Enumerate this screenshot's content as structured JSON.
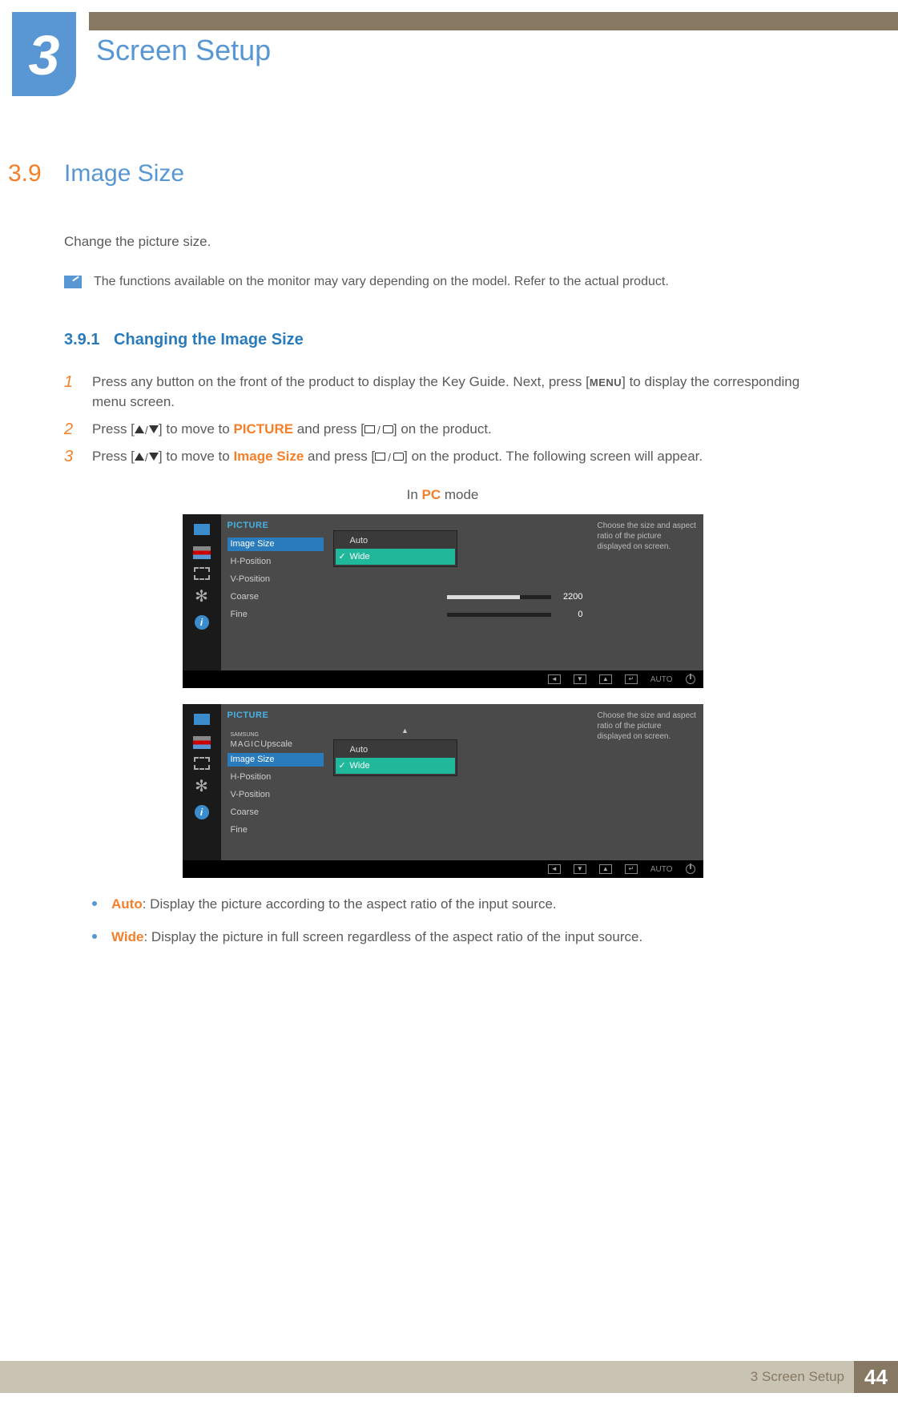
{
  "chapter": {
    "number": "3",
    "title": "Screen Setup"
  },
  "section": {
    "number": "3.9",
    "title": "Image Size"
  },
  "intro": "Change the picture size.",
  "note": "The functions available on the monitor may vary depending on the model. Refer to the actual product.",
  "subsection": {
    "number": "3.9.1",
    "title": "Changing the Image Size"
  },
  "steps": {
    "s1": {
      "pre": "Press any button on the front of the product to display the Key Guide. Next, press [",
      "menu": "MENU",
      "post": "] to display the corresponding menu screen."
    },
    "s2": {
      "pre": "Press [",
      "mid": "] to move to ",
      "kw": "PICTURE",
      "mid2": " and press [",
      "post": "] on the product."
    },
    "s3": {
      "pre": "Press [",
      "mid": "] to move to ",
      "kw": "Image Size",
      "mid2": " and press [",
      "post": "] on the product. The following screen will appear."
    }
  },
  "modeCaption": {
    "pre": "In ",
    "kw": "PC",
    "post": " mode"
  },
  "osd": {
    "header": "PICTURE",
    "desc": "Choose the size and aspect ratio of the picture displayed on screen.",
    "items1": {
      "imageSize": "Image Size",
      "hpos": "H-Position",
      "vpos": "V-Position",
      "coarse": "Coarse",
      "fine": "Fine",
      "coarseVal": "2200",
      "fineVal": "0"
    },
    "items2": {
      "magicBrand": "SAMSUNG",
      "magic": "MAGIC",
      "upscale": "Upscale",
      "imageSize": "Image Size",
      "hpos": "H-Position",
      "vpos": "V-Position",
      "coarse": "Coarse",
      "fine": "Fine"
    },
    "popup": {
      "auto": "Auto",
      "wide": "Wide"
    },
    "footer": {
      "auto": "AUTO"
    }
  },
  "bullets": {
    "auto": {
      "kw": "Auto",
      "text": ": Display the picture according to the aspect ratio of the input source."
    },
    "wide": {
      "kw": "Wide",
      "text": ": Display the picture in full screen regardless of the aspect ratio of the input source."
    }
  },
  "footer": {
    "text": "3 Screen Setup",
    "page": "44"
  }
}
